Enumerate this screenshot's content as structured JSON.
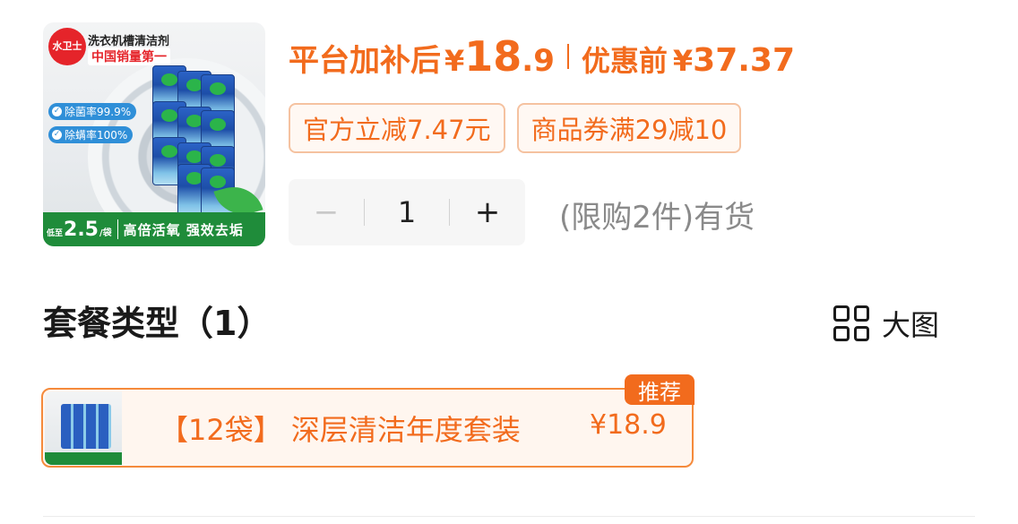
{
  "product": {
    "thumbnail": {
      "brand_logo": "水卫士",
      "title": "洗衣机槽清洁剂",
      "sales_claim": "中国销量第一",
      "feature_1": "除菌率99.9%",
      "feature_2": "除螨率100%",
      "price_prefix": "低至",
      "price_num": "2.5",
      "price_unit": "/袋",
      "slogan": "高倍活氧 强效去垢"
    }
  },
  "price": {
    "subsidy_label": "平台加补后",
    "currency": "¥",
    "subsidy_integer": "18",
    "subsidy_decimal": ".9",
    "original_label": "优惠前",
    "original_price": "37.37"
  },
  "coupons": [
    {
      "label": "官方立减7.47元"
    },
    {
      "label": "商品券满29减10"
    }
  ],
  "quantity": {
    "minus": "−",
    "value": "1",
    "plus": "+",
    "stock_note": "(限购2件)有货"
  },
  "package": {
    "title": "套餐类型（1）",
    "big_view_label": "大图",
    "options": [
      {
        "label": "【12袋】 深层清洁年度套装",
        "price": "¥18.9",
        "badge": "推荐"
      }
    ]
  },
  "colors": {
    "accent": "#f26b1d",
    "coupon_border": "#f5c2a0",
    "option_border": "#f58a3b",
    "muted_text": "#8a8a8a"
  },
  "icons": {
    "big_view": "grid-icon"
  }
}
